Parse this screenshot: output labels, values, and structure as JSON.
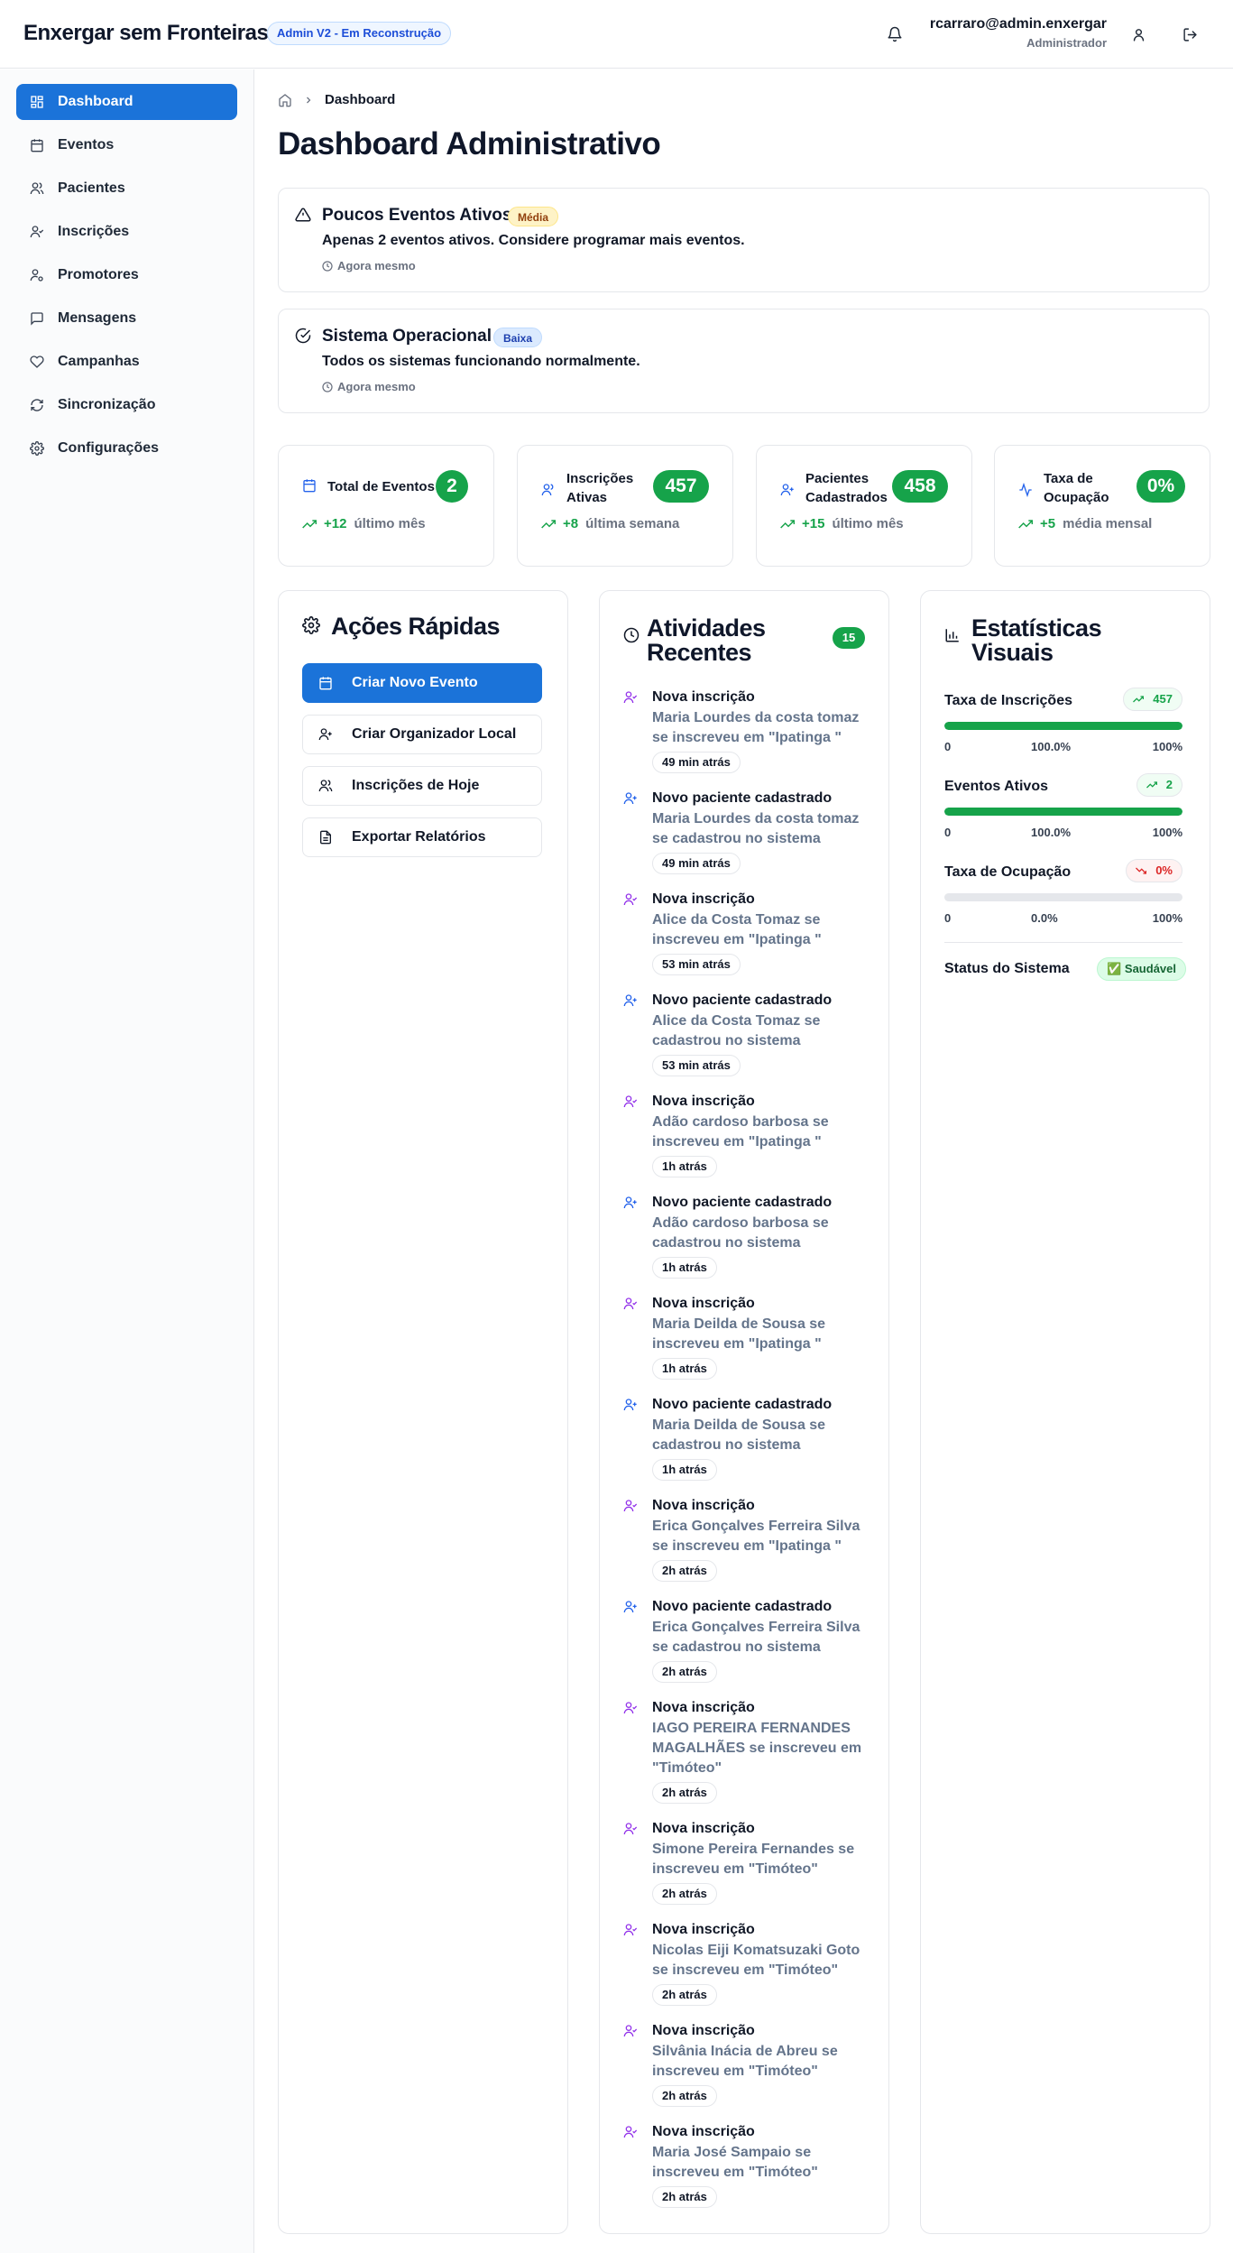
{
  "header": {
    "brand": "Enxergar sem Fronteiras",
    "badge": "Admin V2 - Em Reconstrução",
    "user_email": "rcarraro@admin.enxergar",
    "user_role": "Administrador"
  },
  "sidebar": {
    "items": [
      {
        "label": "Dashboard",
        "icon": "dashboard-icon",
        "active": true
      },
      {
        "label": "Eventos",
        "icon": "calendar-icon"
      },
      {
        "label": "Pacientes",
        "icon": "users-icon"
      },
      {
        "label": "Inscrições",
        "icon": "user-check-icon"
      },
      {
        "label": "Promotores",
        "icon": "user-cog-icon"
      },
      {
        "label": "Mensagens",
        "icon": "message-icon"
      },
      {
        "label": "Campanhas",
        "icon": "heart-icon"
      },
      {
        "label": "Sincronização",
        "icon": "refresh-icon"
      },
      {
        "label": "Configurações",
        "icon": "gear-icon"
      }
    ]
  },
  "breadcrumb": {
    "current": "Dashboard"
  },
  "page_title": "Dashboard Administrativo",
  "alerts": [
    {
      "title": "Poucos Eventos Ativos",
      "badge": "Média",
      "message": "Apenas 2 eventos ativos. Considere programar mais eventos.",
      "time": "Agora mesmo",
      "badge_color": "#fef3c7"
    },
    {
      "title": "Sistema Operacional",
      "badge": "Baixa",
      "message": "Todos os sistemas funcionando normalmente.",
      "time": "Agora mesmo",
      "badge_color": "#dbeafe"
    }
  ],
  "stats": [
    {
      "label": "Total de Eventos",
      "value": "2",
      "delta": "+12",
      "period": "último mês"
    },
    {
      "label": "Inscrições Ativas",
      "value": "457",
      "delta": "+8",
      "period": "última semana"
    },
    {
      "label": "Pacientes Cadastrados",
      "value": "458",
      "delta": "+15",
      "period": "último mês"
    },
    {
      "label": "Taxa de Ocupação",
      "value": "0%",
      "delta": "+5",
      "period": "média mensal"
    }
  ],
  "quick_actions": {
    "title": "Ações Rápidas",
    "buttons": [
      "Criar Novo Evento",
      "Criar Organizador Local",
      "Inscrições de Hoje",
      "Exportar Relatórios"
    ]
  },
  "activities": {
    "title": "Atividades Recentes",
    "count": "15",
    "items": [
      {
        "type": "inscricao",
        "title": "Nova inscrição",
        "desc": "Maria Lourdes da costa tomaz se inscreveu em \"Ipatinga \"",
        "time": "49 min atrás"
      },
      {
        "type": "paciente",
        "title": "Novo paciente cadastrado",
        "desc": "Maria Lourdes da costa tomaz se cadastrou no sistema",
        "time": "49 min atrás"
      },
      {
        "type": "inscricao",
        "title": "Nova inscrição",
        "desc": "Alice da Costa Tomaz se inscreveu em \"Ipatinga \"",
        "time": "53 min atrás"
      },
      {
        "type": "paciente",
        "title": "Novo paciente cadastrado",
        "desc": "Alice da Costa Tomaz se cadastrou no sistema",
        "time": "53 min atrás"
      },
      {
        "type": "inscricao",
        "title": "Nova inscrição",
        "desc": "Adão cardoso barbosa se inscreveu em \"Ipatinga \"",
        "time": "1h atrás"
      },
      {
        "type": "paciente",
        "title": "Novo paciente cadastrado",
        "desc": "Adão cardoso barbosa se cadastrou no sistema",
        "time": "1h atrás"
      },
      {
        "type": "inscricao",
        "title": "Nova inscrição",
        "desc": "Maria Deilda de Sousa se inscreveu em \"Ipatinga \"",
        "time": "1h atrás"
      },
      {
        "type": "paciente",
        "title": "Novo paciente cadastrado",
        "desc": "Maria Deilda de Sousa se cadastrou no sistema",
        "time": "1h atrás"
      },
      {
        "type": "inscricao",
        "title": "Nova inscrição",
        "desc": "Erica Gonçalves Ferreira Silva se inscreveu em \"Ipatinga \"",
        "time": "2h atrás"
      },
      {
        "type": "paciente",
        "title": "Novo paciente cadastrado",
        "desc": "Erica Gonçalves Ferreira Silva se cadastrou no sistema",
        "time": "2h atrás"
      },
      {
        "type": "inscricao",
        "title": "Nova inscrição",
        "desc": "IAGO PEREIRA FERNANDES MAGALHÃES se inscreveu em \"Timóteo\"",
        "time": "2h atrás"
      },
      {
        "type": "inscricao",
        "title": "Nova inscrição",
        "desc": "Simone Pereira Fernandes se inscreveu em \"Timóteo\"",
        "time": "2h atrás"
      },
      {
        "type": "inscricao",
        "title": "Nova inscrição",
        "desc": "Nicolas Eiji Komatsuzaki Goto se inscreveu em \"Timóteo\"",
        "time": "2h atrás"
      },
      {
        "type": "inscricao",
        "title": "Nova inscrição",
        "desc": "Silvânia Inácia de Abreu se inscreveu em \"Timóteo\"",
        "time": "2h atrás"
      },
      {
        "type": "inscricao",
        "title": "Nova inscrição",
        "desc": "Maria José Sampaio se inscreveu em \"Timóteo\"",
        "time": "2h atrás"
      }
    ]
  },
  "visual_stats": {
    "title": "Estatísticas Visuais",
    "rows": [
      {
        "label": "Taxa de Inscrições",
        "badge": "457",
        "trend": "up",
        "fill": 1.0,
        "min": "0",
        "mid": "100.0%",
        "max": "100%"
      },
      {
        "label": "Eventos Ativos",
        "badge": "2",
        "trend": "up",
        "fill": 1.0,
        "min": "0",
        "mid": "100.0%",
        "max": "100%"
      },
      {
        "label": "Taxa de Ocupação",
        "badge": "0%",
        "trend": "down",
        "fill": 0.0,
        "min": "0",
        "mid": "0.0%",
        "max": "100%"
      }
    ],
    "status_label": "Status do Sistema",
    "status_value": "Saudável",
    "status_check": "✅"
  },
  "colors": {
    "primary": "#1b73d9",
    "success": "#16a34a",
    "danger": "#dc2626",
    "inscricao_icon": "#9333ea",
    "paciente_icon": "#2563eb"
  }
}
